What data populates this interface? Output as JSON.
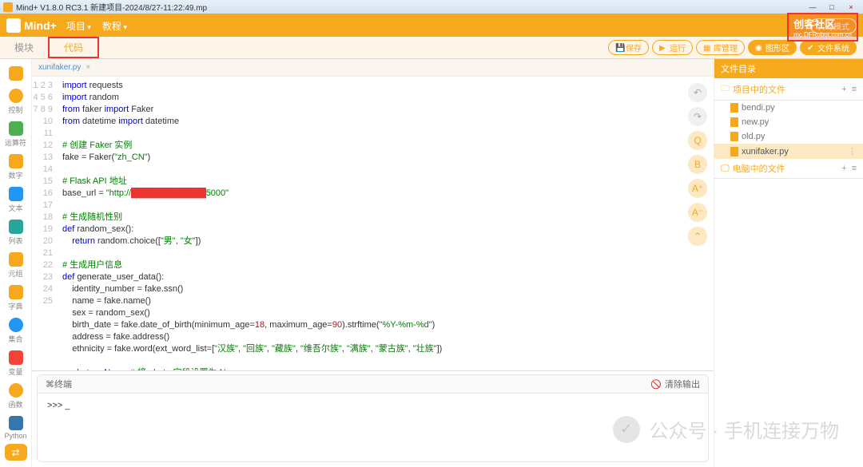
{
  "window": {
    "title": "Mind+ V1.8.0 RC3.1   新建项目-2024/8/27-11:22:49.mp",
    "min": "—",
    "max": "□",
    "close": "×"
  },
  "top": {
    "logo": "Mind+",
    "menu_project": "项目",
    "menu_tutorial": "教程",
    "realtime": "实时模式",
    "community_title": "创客社区",
    "community_sub": "mc.DFRobot.com.cn"
  },
  "tabs": {
    "blocks": "模块",
    "code": "代码",
    "save": "保存",
    "run": "运行",
    "lib": "库管理",
    "graphics": "图形区",
    "filesys": "文件系统"
  },
  "sidebar": {
    "control": "控制",
    "operator": "运算符",
    "number": "数字",
    "text": "文本",
    "list": "列表",
    "tuple": "元组",
    "dict": "字典",
    "set": "集合",
    "variable": "变量",
    "function": "函数",
    "python": "Python"
  },
  "file": {
    "tab": "xunifaker.py"
  },
  "code": {
    "lines": [
      "1",
      "2",
      "3",
      "4",
      "5",
      "6",
      "7",
      "8",
      "9",
      "10",
      "11",
      "12",
      "13",
      "14",
      "15",
      "16",
      "17",
      "18",
      "19",
      "20",
      "21",
      "22",
      "23",
      "24",
      "25"
    ],
    "l1a": "import",
    "l1b": " requests",
    "l2a": "import",
    "l2b": " random",
    "l3a": "from",
    "l3b": " faker ",
    "l3c": "import",
    "l3d": " Faker",
    "l4a": "from",
    "l4b": " datetime ",
    "l4c": "import",
    "l4d": " datetime",
    "l6": "# 创建 Faker 实例",
    "l7a": "fake = Faker(",
    "l7b": "\"zh_CN\"",
    "l7c": ")",
    "l9": "# Flask API 地址",
    "l10a": "base_url = ",
    "l10b": "\"http://",
    "l10c": "████████████",
    "l10d": "5000\"",
    "l12": "# 生成随机性别",
    "l13a": "def",
    "l13b": " random_sex():",
    "l14a": "    return",
    "l14b": " random.choice([",
    "l14c": "\"男\"",
    "l14d": ", ",
    "l14e": "\"女\"",
    "l14f": "])",
    "l16": "# 生成用户信息",
    "l17a": "def",
    "l17b": " generate_user_data():",
    "l18": "    identity_number = fake.ssn()",
    "l19": "    name = fake.name()",
    "l20": "    sex = random_sex()",
    "l21a": "    birth_date = fake.date_of_birth(minimum_age=",
    "l21b": "18",
    "l21c": ", maximum_age=",
    "l21d": "90",
    "l21e": ").strftime(",
    "l21f": "\"%Y-%m-%d\"",
    "l21g": ")",
    "l22": "    address = fake.address()",
    "l23a": "    ethnicity = fake.word(ext_word_list=[",
    "l23b": "\"汉族\"",
    "l23c": ", ",
    "l23d": "\"回族\"",
    "l23e": ", ",
    "l23f": "\"藏族\"",
    "l23g": ", ",
    "l23h": "\"维吾尔族\"",
    "l23i": ", ",
    "l23j": "\"满族\"",
    "l23k": ", ",
    "l23l": "\"蒙古族\"",
    "l23m": ", ",
    "l23n": "\"壮族\"",
    "l23o": "])",
    "l25a": "    photo = ",
    "l25b": "None",
    "l25c": "  ",
    "l25d": "# 将 photo 字段设置为 None"
  },
  "sidebtns": {
    "undo": "↶",
    "redo": "↷",
    "search": "Q",
    "b": "B",
    "aplus": "A⁺",
    "aminus": "A⁻",
    "top": "⌃"
  },
  "terminal": {
    "title": "终端",
    "clear": "清除输出",
    "prompt": ">>> _"
  },
  "right": {
    "title": "文件目录",
    "project_files": "项目中的文件",
    "computer_files": "电脑中的文件",
    "files": {
      "f0": "bendi.py",
      "f1": "new.py",
      "f2": "old.py",
      "f3": "xunifaker.py"
    },
    "add": "+",
    "menu": "≡",
    "dots": "⋮"
  },
  "watermark": {
    "label": "公众号 · 手机连接万物",
    "icon": "✓"
  }
}
